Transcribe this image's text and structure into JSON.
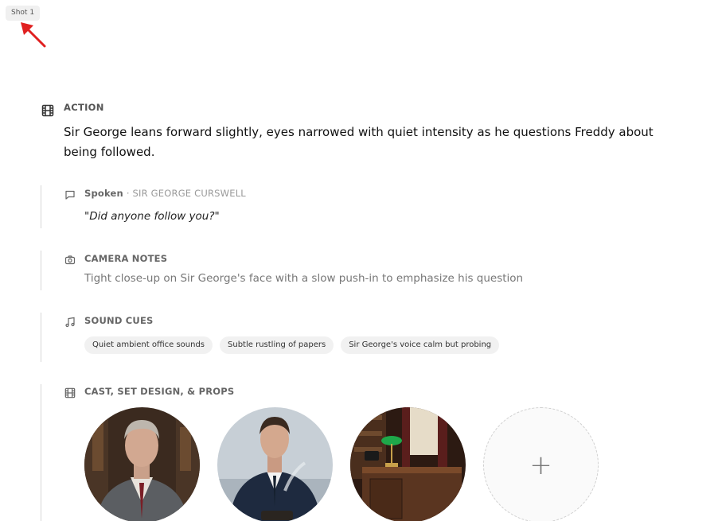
{
  "shot": {
    "label": "Shot 1"
  },
  "action": {
    "label": "ACTION",
    "text": "Sir George leans forward slightly, eyes narrowed with quiet intensity as he questions Freddy about being followed."
  },
  "spoken": {
    "label": "Spoken",
    "separator": "·",
    "speaker": "SIR GEORGE CURSWELL",
    "line": "\"Did anyone follow you?\""
  },
  "camera_notes": {
    "label": "CAMERA NOTES",
    "text": "Tight close-up on Sir George's face with a slow push-in to emphasize his question"
  },
  "sound_cues": {
    "label": "SOUND CUES",
    "items": [
      "Quiet ambient office sounds",
      "Subtle rustling of papers",
      "Sir George's voice calm but probing"
    ]
  },
  "cast": {
    "label": "CAST, SET DESIGN, & PROPS",
    "add_symbol": "+"
  },
  "colors": {
    "annotation_arrow": "#e02020",
    "lamp_green": "#1ea84a"
  },
  "icons": [
    "film-icon",
    "speech-bubble-icon",
    "camera-icon",
    "music-note-icon",
    "film-icon",
    "plus-icon"
  ]
}
